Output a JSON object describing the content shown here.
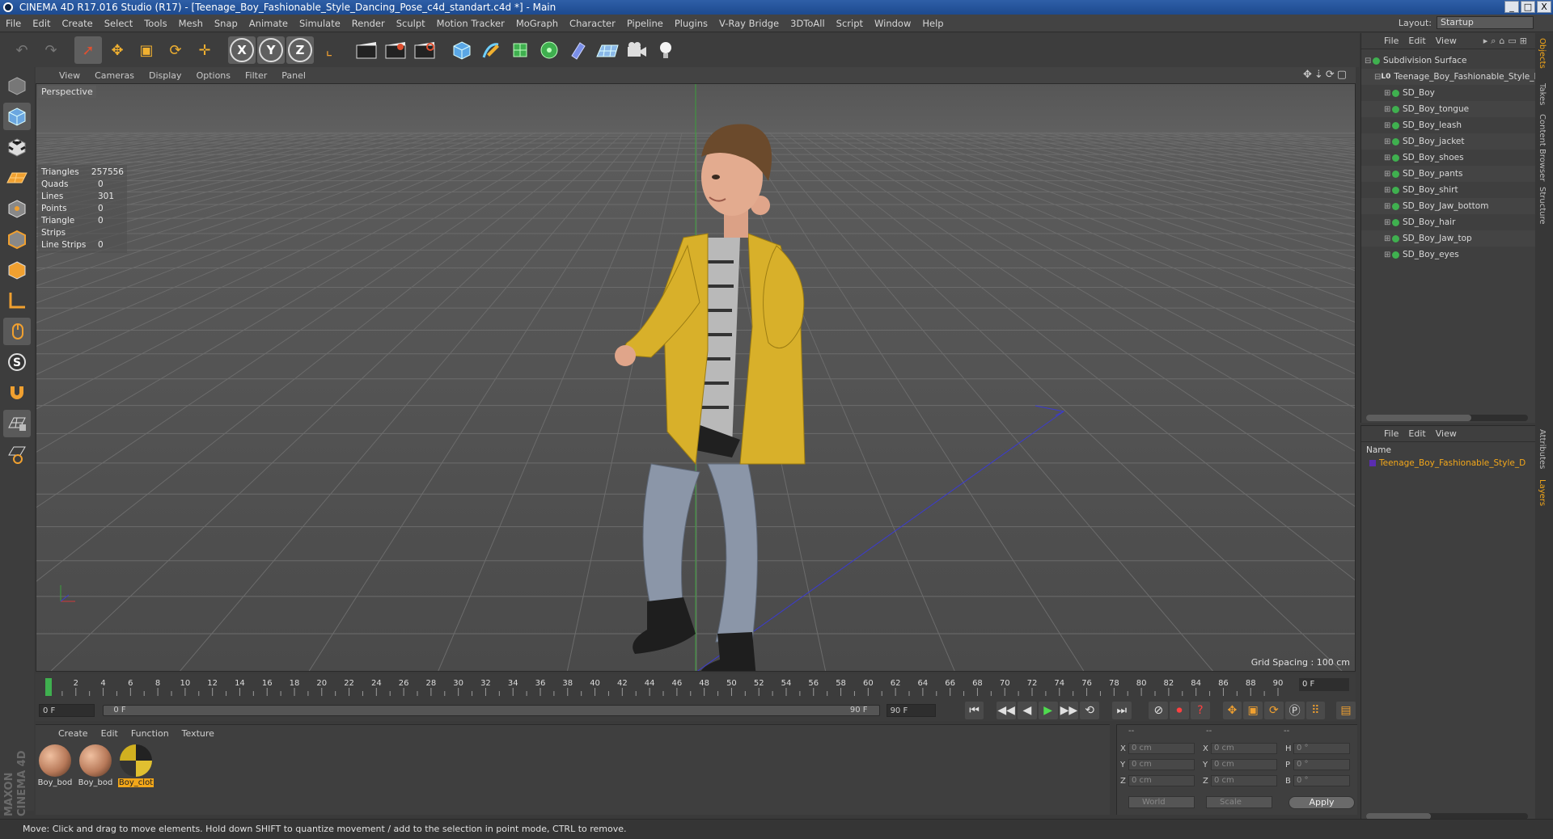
{
  "window": {
    "title": "CINEMA 4D R17.016 Studio (R17) - [Teenage_Boy_Fashionable_Style_Dancing_Pose_c4d_standart.c4d *] - Main",
    "controls": [
      "_",
      "□",
      "X"
    ]
  },
  "menubar": {
    "items": [
      "File",
      "Edit",
      "Create",
      "Select",
      "Tools",
      "Mesh",
      "Snap",
      "Animate",
      "Simulate",
      "Render",
      "Sculpt",
      "Motion Tracker",
      "MoGraph",
      "Character",
      "Pipeline",
      "Plugins",
      "V-Ray Bridge",
      "3DToAll",
      "Script",
      "Window",
      "Help"
    ],
    "layout_label": "Layout:",
    "layout_value": "Startup"
  },
  "toolbar": {
    "undo_icon": "↶",
    "redo_icon": "↷",
    "select_icon": "➚",
    "move_icon": "✥",
    "scale_icon": "▣",
    "rotate_icon": "⟳",
    "transform_icon": "✛",
    "axis_x": "X",
    "axis_y": "Y",
    "axis_z": "Z",
    "coord_icon": "⌞"
  },
  "viewport": {
    "menu": [
      "View",
      "Cameras",
      "Display",
      "Options",
      "Filter",
      "Panel"
    ],
    "label": "Perspective",
    "stats": [
      {
        "name": "Triangles",
        "value": "257556"
      },
      {
        "name": "Quads",
        "value": "0"
      },
      {
        "name": "Lines",
        "value": "301"
      },
      {
        "name": "Points",
        "value": "0"
      },
      {
        "name": "Triangle Strips",
        "value": "0"
      },
      {
        "name": "Line Strips",
        "value": "0"
      }
    ],
    "grid_spacing": "Grid Spacing : 100 cm",
    "nav_icons": "✥⇣⟳▢"
  },
  "timeline": {
    "ticks": [
      "0",
      "2",
      "4",
      "6",
      "8",
      "10",
      "12",
      "14",
      "16",
      "18",
      "20",
      "22",
      "24",
      "26",
      "28",
      "30",
      "32",
      "34",
      "36",
      "38",
      "40",
      "42",
      "44",
      "46",
      "48",
      "50",
      "52",
      "54",
      "56",
      "58",
      "60",
      "62",
      "64",
      "66",
      "68",
      "70",
      "72",
      "74",
      "76",
      "78",
      "80",
      "82",
      "84",
      "86",
      "88",
      "90"
    ],
    "current_frame": "0 F"
  },
  "playback": {
    "start": "0 F",
    "range_start": "0 F",
    "range_end": "90 F",
    "end": "90 F",
    "buttons": [
      "⏮",
      "◀◀",
      "◀",
      "▶",
      "▶▶",
      "⟲",
      "⏭"
    ]
  },
  "material_manager": {
    "menu": [
      "Create",
      "Edit",
      "Function",
      "Texture"
    ],
    "materials": [
      {
        "label": "Boy_bod",
        "color": "#b87a5a",
        "selected": false
      },
      {
        "label": "Boy_bod",
        "color": "#b87a5a",
        "selected": false
      },
      {
        "label": "Boy_clot",
        "color": "#2a2a2a",
        "selected": true
      }
    ],
    "brand_top": "MAXON",
    "brand_bottom": "CINEMA 4D"
  },
  "coordinates": {
    "headers": [
      "--",
      "--",
      "--"
    ],
    "rows": [
      {
        "axis": "X",
        "pos": "0 cm",
        "axis2": "X",
        "size": "0 cm",
        "axis3": "H",
        "rot": "0 °"
      },
      {
        "axis": "Y",
        "pos": "0 cm",
        "axis2": "Y",
        "size": "0 cm",
        "axis3": "P",
        "rot": "0 °"
      },
      {
        "axis": "Z",
        "pos": "0 cm",
        "axis2": "Z",
        "size": "0 cm",
        "axis3": "B",
        "rot": "0 °"
      }
    ],
    "mode": "World",
    "scale_mode": "Scale",
    "apply": "Apply"
  },
  "object_manager": {
    "menu": [
      "File",
      "Edit",
      "View"
    ],
    "tree": [
      {
        "label": "Subdivision Surface",
        "depth": 0,
        "kind": "green"
      },
      {
        "label": "Teenage_Boy_Fashionable_Style_D",
        "depth": 1,
        "kind": "lo"
      },
      {
        "label": "SD_Boy",
        "depth": 2,
        "kind": "green"
      },
      {
        "label": "SD_Boy_tongue",
        "depth": 2,
        "kind": "green"
      },
      {
        "label": "SD_Boy_leash",
        "depth": 2,
        "kind": "green"
      },
      {
        "label": "SD_Boy_jacket",
        "depth": 2,
        "kind": "green"
      },
      {
        "label": "SD_Boy_shoes",
        "depth": 2,
        "kind": "green"
      },
      {
        "label": "SD_Boy_pants",
        "depth": 2,
        "kind": "green"
      },
      {
        "label": "SD_Boy_shirt",
        "depth": 2,
        "kind": "green"
      },
      {
        "label": "SD_Boy_Jaw_bottom",
        "depth": 2,
        "kind": "green"
      },
      {
        "label": "SD_Boy_hair",
        "depth": 2,
        "kind": "green"
      },
      {
        "label": "SD_Boy_Jaw_top",
        "depth": 2,
        "kind": "green"
      },
      {
        "label": "SD_Boy_eyes",
        "depth": 2,
        "kind": "green"
      }
    ]
  },
  "layer_manager": {
    "menu": [
      "File",
      "Edit",
      "View"
    ],
    "column": "Name",
    "layer": "Teenage_Boy_Fashionable_Style_D"
  },
  "right_tabs": [
    "Objects",
    "Takes",
    "Content Browser",
    "Structure",
    "Attributes",
    "Layers"
  ],
  "status": "Move: Click and drag to move elements. Hold down SHIFT to quantize movement / add to the selection in point mode, CTRL to remove."
}
